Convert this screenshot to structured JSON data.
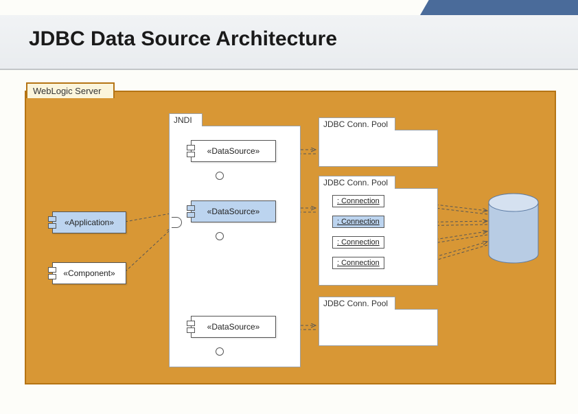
{
  "title": "JDBC Data Source Architecture",
  "server_label": "WebLogic Server",
  "jndi_label": "JNDI",
  "left": {
    "application": "«Application»",
    "component": "«Component»"
  },
  "datasources": [
    "«DataSource»",
    "«DataSource»",
    "«DataSource»"
  ],
  "pools": {
    "label": "JDBC Conn. Pool",
    "items": [
      {
        "connections": []
      },
      {
        "connections": [
          ": Connection",
          ": Connection",
          ": Connection",
          ": Connection"
        ]
      },
      {
        "connections": []
      }
    ]
  }
}
